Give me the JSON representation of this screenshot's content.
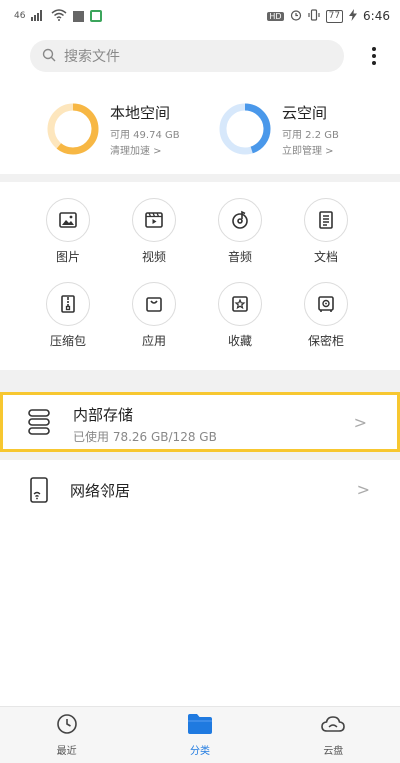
{
  "status_bar": {
    "left_signal": "46",
    "battery": "77",
    "time": "6:46",
    "hd": "HD"
  },
  "search": {
    "placeholder": "搜索文件"
  },
  "storage": {
    "local": {
      "title": "本地空间",
      "subtitle": "可用 49.74 GB",
      "link": "清理加速 >",
      "used_fraction": 0.61,
      "color": "#f7b744"
    },
    "cloud": {
      "title": "云空间",
      "subtitle": "可用 2.2 GB",
      "link": "立即管理 >",
      "used_fraction": 0.45,
      "color": "#4a98ea"
    }
  },
  "categories": [
    {
      "label": "图片",
      "icon": "picture-icon"
    },
    {
      "label": "视频",
      "icon": "video-icon"
    },
    {
      "label": "音频",
      "icon": "audio-icon"
    },
    {
      "label": "文档",
      "icon": "document-icon"
    },
    {
      "label": "压缩包",
      "icon": "archive-icon"
    },
    {
      "label": "应用",
      "icon": "app-bag-icon"
    },
    {
      "label": "收藏",
      "icon": "star-icon"
    },
    {
      "label": "保密柜",
      "icon": "safe-icon"
    }
  ],
  "internal_storage": {
    "title": "内部存储",
    "subtitle": "已使用 78.26 GB/128 GB",
    "chevron": ">"
  },
  "network": {
    "title": "网络邻居",
    "chevron": ">"
  },
  "bottom_nav": {
    "recent": "最近",
    "category": "分类",
    "cloud": "云盘",
    "active": "category",
    "active_color": "#1f7ae0"
  }
}
